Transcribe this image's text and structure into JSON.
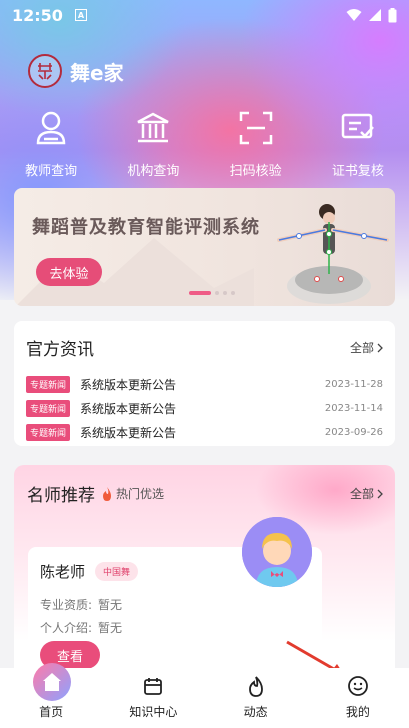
{
  "status_bar": {
    "time": "12:50",
    "indicator": "A"
  },
  "app": {
    "title": "舞e家"
  },
  "quick_actions": [
    {
      "label": "教师查询",
      "icon": "person-search-icon"
    },
    {
      "label": "机构查询",
      "icon": "institution-icon"
    },
    {
      "label": "扫码核验",
      "icon": "scan-icon"
    },
    {
      "label": "证书复核",
      "icon": "certificate-icon"
    }
  ],
  "banner": {
    "title": "舞蹈普及教育智能评测系统",
    "button": "去体验",
    "pages": 4,
    "active_page": 1
  },
  "news": {
    "title": "官方资讯",
    "more": "全部",
    "items": [
      {
        "tag": "专题新闻",
        "title": "系统版本更新公告",
        "date": "2023-11-28"
      },
      {
        "tag": "专题新闻",
        "title": "系统版本更新公告",
        "date": "2023-11-14"
      },
      {
        "tag": "专题新闻",
        "title": "系统版本更新公告",
        "date": "2023-09-26"
      }
    ]
  },
  "teachers": {
    "title": "名师推荐",
    "hot_label": "热门优选",
    "more": "全部",
    "card": {
      "name": "陈老师",
      "badge": "中国舞",
      "qual_label": "专业资质:",
      "qual_value": "暂无",
      "intro_label": "个人介绍:",
      "intro_value": "暂无",
      "button": "查看"
    }
  },
  "tabbar": [
    {
      "label": "首页",
      "icon": "home-icon",
      "active": true
    },
    {
      "label": "知识中心",
      "icon": "calendar-icon",
      "active": false
    },
    {
      "label": "动态",
      "icon": "flame-icon",
      "active": false
    },
    {
      "label": "我的",
      "icon": "smiley-icon",
      "active": false
    }
  ],
  "colors": {
    "accent": "#e94d7b",
    "banner_btn": "#e64d78"
  }
}
